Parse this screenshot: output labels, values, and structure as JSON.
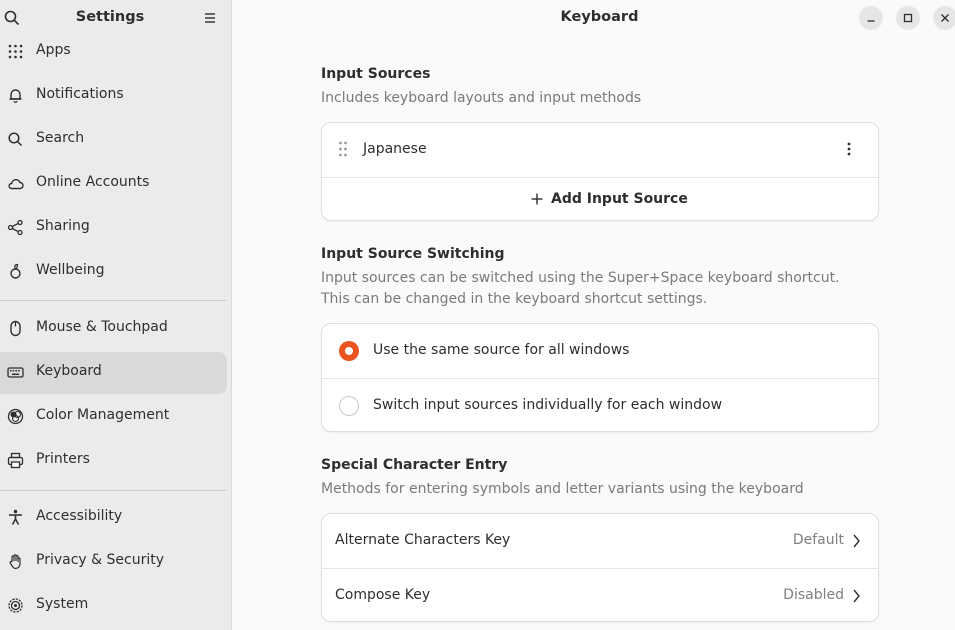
{
  "sidebar": {
    "title": "Settings",
    "items": [
      {
        "label": "Apps",
        "icon": "apps-grid-icon"
      },
      {
        "label": "Notifications",
        "icon": "bell-icon"
      },
      {
        "label": "Search",
        "icon": "search-icon"
      },
      {
        "label": "Online Accounts",
        "icon": "cloud-icon"
      },
      {
        "label": "Sharing",
        "icon": "share-icon"
      },
      {
        "label": "Wellbeing",
        "icon": "wellbeing-icon"
      },
      {
        "label": "Mouse & Touchpad",
        "icon": "mouse-icon"
      },
      {
        "label": "Keyboard",
        "icon": "keyboard-icon",
        "active": true
      },
      {
        "label": "Color Management",
        "icon": "color-icon"
      },
      {
        "label": "Printers",
        "icon": "printer-icon"
      },
      {
        "label": "Accessibility",
        "icon": "accessibility-icon"
      },
      {
        "label": "Privacy & Security",
        "icon": "hand-icon"
      },
      {
        "label": "System",
        "icon": "system-gear-icon"
      }
    ]
  },
  "window": {
    "title": "Keyboard"
  },
  "input_sources": {
    "title": "Input Sources",
    "description": "Includes keyboard layouts and input methods",
    "sources": [
      "Japanese"
    ],
    "add_label": "Add Input Source"
  },
  "switching": {
    "title": "Input Source Switching",
    "description_line1": "Input sources can be switched using the Super+Space keyboard shortcut.",
    "description_line2": "This can be changed in the keyboard shortcut settings.",
    "options": [
      {
        "label": "Use the same source for all windows",
        "selected": true
      },
      {
        "label": "Switch input sources individually for each window",
        "selected": false
      }
    ]
  },
  "special": {
    "title": "Special Character Entry",
    "description": "Methods for entering symbols and letter variants using the keyboard",
    "rows": [
      {
        "label": "Alternate Characters Key",
        "value": "Default"
      },
      {
        "label": "Compose Key",
        "value": "Disabled"
      }
    ]
  },
  "colors": {
    "accent": "#e95420"
  }
}
